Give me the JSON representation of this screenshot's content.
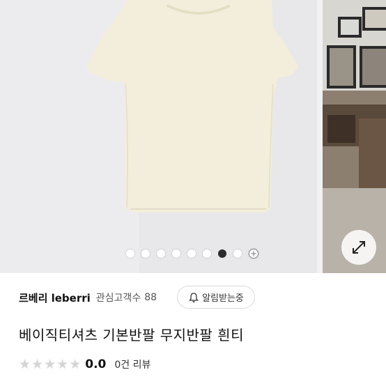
{
  "gallery": {
    "dot_count": 8,
    "active_dot": 7,
    "add_symbol": "+",
    "expand_icon": "expand-diagonal-icon"
  },
  "shop": {
    "name": "르베리 leberri",
    "interest_label": "관심고객수",
    "interest_count": "88"
  },
  "alert_button": {
    "icon": "bell-icon",
    "label": "알림받는중"
  },
  "product": {
    "title": "베이직티셔츠 기본반팔 무지반팔 흰티"
  },
  "rating": {
    "stars": 5,
    "star_glyph": "★",
    "value": "0.0",
    "review_text": "0건 리뷰"
  },
  "colors": {
    "shirt": "#f3eedb",
    "wall": "#e9e9ec",
    "active_dot": "#2b2b2b",
    "star_empty": "#d4d4d4"
  }
}
